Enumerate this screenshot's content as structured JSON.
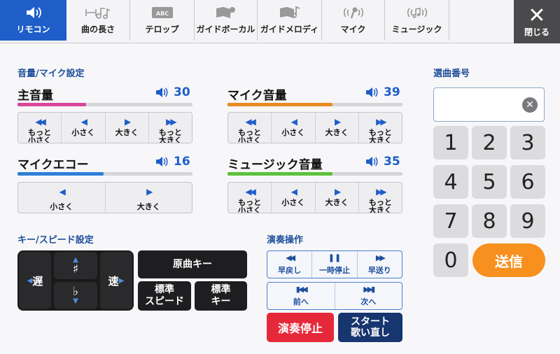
{
  "tabs": [
    {
      "label": "リモコン",
      "icon": "speaker-icon",
      "active": true
    },
    {
      "label": "曲の長さ",
      "icon": "note-length-icon",
      "active": false
    },
    {
      "label": "テロップ",
      "icon": "telop-icon",
      "active": false
    },
    {
      "label": "ガイドボーカル",
      "icon": "guide-vocal-icon",
      "active": false
    },
    {
      "label": "ガイドメロディ",
      "icon": "guide-melody-icon",
      "active": false
    },
    {
      "label": "マイク",
      "icon": "mic-icon",
      "active": false
    },
    {
      "label": "ミュージック",
      "icon": "music-icon",
      "active": false
    }
  ],
  "close_label": "閉じる",
  "volume": {
    "title": "音量/マイク設定",
    "main": {
      "label": "主音量",
      "value": "30",
      "level": 0.39,
      "color": "#d9469b"
    },
    "mic": {
      "label": "マイク音量",
      "value": "39",
      "level": 0.6,
      "color": "#e88a23"
    },
    "echo": {
      "label": "マイクエコー",
      "value": "16",
      "level": 0.49,
      "color": "#2f7fd6"
    },
    "music": {
      "label": "ミュージック音量",
      "value": "35",
      "level": 0.6,
      "color": "#5cc23a"
    },
    "more_down_1": "もっと",
    "more_down_2": "小さく",
    "down": "小さく",
    "up": "大きく",
    "more_up_1": "もっと",
    "more_up_2": "大きく"
  },
  "key": {
    "title": "キー/スピード設定",
    "slow": "遅",
    "fast": "速",
    "sharp": "♯",
    "flat": "♭",
    "original_key": "原曲キー",
    "std_speed_1": "標準",
    "std_speed_2": "スピード",
    "std_key_1": "標準",
    "std_key_2": "キー"
  },
  "perform": {
    "title": "演奏操作",
    "rewind": "早戻し",
    "pause": "一時停止",
    "forward": "早送り",
    "prev": "前へ",
    "next": "次へ",
    "stop": "演奏停止",
    "restart_1": "スタート",
    "restart_2": "歌い直し"
  },
  "song": {
    "title": "選曲番号",
    "value": "",
    "keys": [
      "1",
      "2",
      "3",
      "4",
      "5",
      "6",
      "7",
      "8",
      "9",
      "0"
    ],
    "send": "送信"
  }
}
